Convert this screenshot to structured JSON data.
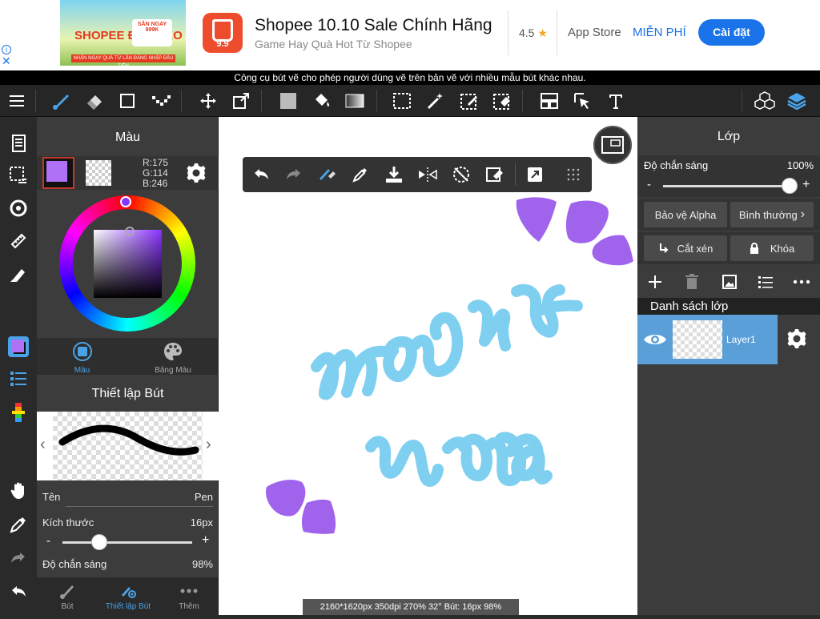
{
  "ad": {
    "thumb_title": "SHOPEE ĐẬP KẸO",
    "thumb_badge": "SĂN NGAY 999K",
    "thumb_footer": "NHẬN NGAY QUÀ TỪ LẦN ĐĂNG NHẬP ĐẦU TIÊN",
    "app_badge": "9.9",
    "title": "Shopee 10.10 Sale Chính Hãng",
    "subtitle": "Game Hay Quà Hot Từ Shopee",
    "rating": "4.5",
    "store": "App Store",
    "price": "MIỄN PHÍ",
    "install": "Cài đặt",
    "info": "i",
    "close": "✕"
  },
  "tooltip": "Công cụ bút vẽ cho phép người dùng vẽ trên bản vẽ với nhiều mẫu bút khác nhau.",
  "color_panel": {
    "title": "Màu",
    "rgb_r": "R:175",
    "rgb_g": "G:114",
    "rgb_b": "B:246",
    "current_color": "#af72f6",
    "tab_color": "Màu",
    "tab_palette": "Bảng Màu"
  },
  "brush_panel": {
    "title": "Thiết lập Bút",
    "name_label": "Tên",
    "name_value": "Pen",
    "size_label": "Kích thước",
    "size_value": "16px",
    "size_level": 0.25,
    "opacity_label": "Độ chắn sáng",
    "opacity_value": "98%",
    "minus": "-",
    "plus": "+"
  },
  "bottom_tabs": {
    "brush": "Bút",
    "brush_settings": "Thiết lập Bút",
    "more": "Thêm"
  },
  "status": "2160*1620px 350dpi 270% 32° Bút: 16px 98%",
  "layer_panel": {
    "title": "Lớp",
    "opacity_label": "Độ chắn sáng",
    "opacity_value": "100%",
    "opacity_level": 1.0,
    "minus": "-",
    "plus": "+",
    "protect_alpha": "Bảo vệ Alpha",
    "blend_mode": "Bình thường",
    "clip": "Cắt xén",
    "lock": "Khóa",
    "list_title": "Danh sách lớp",
    "layers": [
      {
        "name": "Layer1"
      }
    ]
  },
  "colors": {
    "accent": "#5a9fd8",
    "brush_stroke": "#7fd0f0",
    "purple": "#a064ec"
  }
}
